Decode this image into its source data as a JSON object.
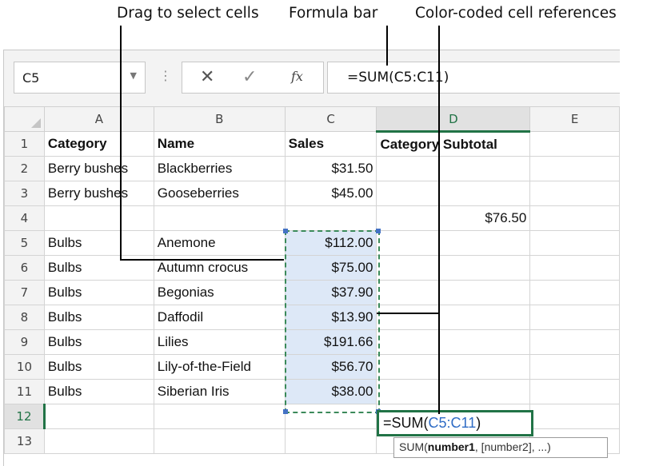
{
  "callouts": {
    "drag": "Drag to select cells",
    "formula_bar": "Formula bar",
    "color_refs": "Color-coded cell references"
  },
  "name_box": {
    "value": "C5",
    "dropdown_icon": "chevron-down-icon"
  },
  "formula_buttons": {
    "cancel": "✕",
    "enter": "✓",
    "fx": "fx"
  },
  "formula_bar": {
    "value": "=SUM(C5:C11)"
  },
  "columns": [
    "A",
    "B",
    "C",
    "D",
    "E"
  ],
  "rows": [
    {
      "num": "1",
      "a": "Category",
      "b": "Name",
      "c": "Sales",
      "d": "Category Subtotal"
    },
    {
      "num": "2",
      "a": "Berry bushes",
      "b": "Blackberries",
      "c": "$31.50",
      "d": ""
    },
    {
      "num": "3",
      "a": "Berry bushes",
      "b": "Gooseberries",
      "c": "$45.00",
      "d": ""
    },
    {
      "num": "4",
      "a": "",
      "b": "",
      "c": "",
      "d": "$76.50"
    },
    {
      "num": "5",
      "a": "Bulbs",
      "b": "Anemone",
      "c": "$112.00",
      "d": ""
    },
    {
      "num": "6",
      "a": "Bulbs",
      "b": "Autumn crocus",
      "c": "$75.00",
      "d": ""
    },
    {
      "num": "7",
      "a": "Bulbs",
      "b": "Begonias",
      "c": "$37.90",
      "d": ""
    },
    {
      "num": "8",
      "a": "Bulbs",
      "b": "Daffodil",
      "c": "$13.90",
      "d": ""
    },
    {
      "num": "9",
      "a": "Bulbs",
      "b": "Lilies",
      "c": "$191.66",
      "d": ""
    },
    {
      "num": "10",
      "a": "Bulbs",
      "b": "Lily-of-the-Field",
      "c": "$56.70",
      "d": ""
    },
    {
      "num": "11",
      "a": "Bulbs",
      "b": "Siberian Iris",
      "c": "$38.00",
      "d": ""
    },
    {
      "num": "12",
      "a": "",
      "b": "",
      "c": "",
      "d": ""
    },
    {
      "num": "13",
      "a": "",
      "b": "",
      "c": "",
      "d": ""
    }
  ],
  "edit_cell": {
    "prefix": "=SUM(",
    "ref": "C5:C11",
    "suffix": ")"
  },
  "tooltip": {
    "fn": "SUM(",
    "arg1": "number1",
    "rest": ", [number2], ...)"
  },
  "colors": {
    "accent_green": "#217346",
    "ref_blue": "#2f6cc5",
    "selection_fill": "#dde8f7"
  }
}
